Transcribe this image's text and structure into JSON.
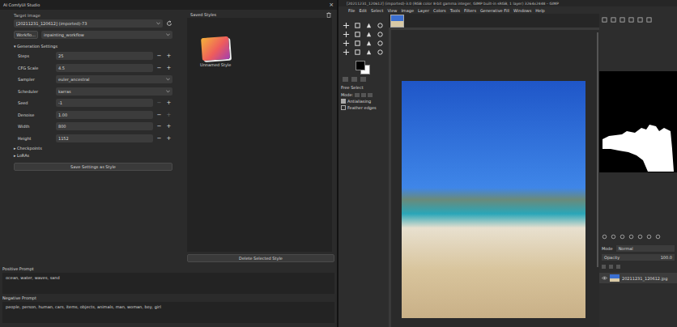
{
  "studio": {
    "title": "AI ComfyUI Studio",
    "close": "×",
    "target_image": {
      "label": "Target Image",
      "value": "[20211231_120612] (imported)-73"
    },
    "workflow": {
      "button": "Workflo...",
      "value": "inpainting_workflow"
    },
    "generation_settings": {
      "label": "Generation Settings",
      "arrow": "▾",
      "expanded": true
    },
    "settings": [
      {
        "label": "Steps",
        "value": "25",
        "kind": "spin",
        "minus_disabled": false,
        "plus_disabled": false
      },
      {
        "label": "CFG Scale",
        "value": "4.5",
        "kind": "spin",
        "minus_disabled": false,
        "plus_disabled": false
      },
      {
        "label": "Sampler",
        "value": "euler_ancestral",
        "kind": "select",
        "minus_disabled": false,
        "plus_disabled": false
      },
      {
        "label": "Scheduler",
        "value": "karras",
        "kind": "select",
        "minus_disabled": false,
        "plus_disabled": false
      },
      {
        "label": "Seed",
        "value": "-1",
        "kind": "spin",
        "minus_disabled": true,
        "plus_disabled": false
      },
      {
        "label": "Denoise",
        "value": "1.00",
        "kind": "spin",
        "minus_disabled": false,
        "plus_disabled": true
      },
      {
        "label": "Width",
        "value": "800",
        "kind": "spin",
        "minus_disabled": false,
        "plus_disabled": false
      },
      {
        "label": "Height",
        "value": "1152",
        "kind": "spin",
        "minus_disabled": false,
        "plus_disabled": false
      }
    ],
    "spin_minus": "−",
    "spin_plus": "+",
    "sections": [
      {
        "label": "Checkpoints",
        "arrow": "▸",
        "expanded": false
      },
      {
        "label": "LoRAs",
        "arrow": "▸",
        "expanded": false
      }
    ],
    "save_button": "Save Settings as Style",
    "saved_styles": {
      "title": "Saved Styles",
      "items": [
        {
          "name": "Unnamed Style",
          "selected": false
        }
      ],
      "delete_button": "Delete Selected Style"
    },
    "positive_prompt": {
      "label": "Positive Prompt",
      "value": "ocean, water, waves, sand"
    },
    "negative_prompt": {
      "label": "Negative Prompt",
      "value": "people, person, human, cars, items, objects, animals, man, woman, boy, girl"
    }
  },
  "gimp": {
    "title": "[20211231_120612] (imported)-3.0 (RGB color 8-bit gamma integer, GIMP built-in sRGB, 1 layer) 3264x2448 – GIMP",
    "menu": [
      "File",
      "Edit",
      "Select",
      "View",
      "Image",
      "Layer",
      "Colors",
      "Tools",
      "Filters",
      "Generative Fill",
      "Windows",
      "Help"
    ],
    "tool_options": {
      "tool": "Free Select",
      "mode_label": "Mode:",
      "options": [
        {
          "label": "Antialiasing",
          "checked": true
        },
        {
          "label": "Feather edges",
          "checked": false
        }
      ]
    },
    "layers_panel": {
      "mode_label": "Mode",
      "mode": "Normal",
      "opacity_label": "Opacity",
      "opacity": "100.0",
      "layers": [
        {
          "name": "20211231_120612.jpg",
          "visible": true,
          "selected": true
        }
      ]
    }
  }
}
